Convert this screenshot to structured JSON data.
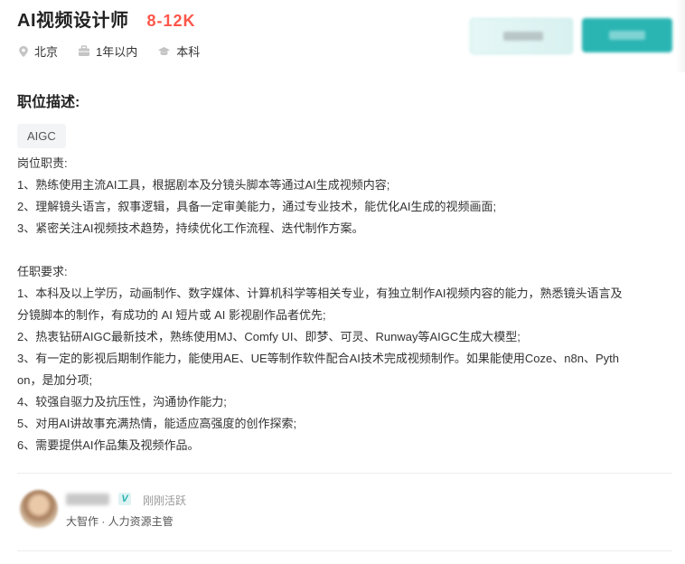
{
  "job": {
    "title": "AI视频设计师",
    "salary": "8-12K",
    "location": "北京",
    "experience": "1年以内",
    "education": "本科"
  },
  "icons": {
    "location": "location-pin-icon",
    "experience": "briefcase-icon",
    "education": "graduation-cap-icon"
  },
  "description": {
    "heading": "职位描述:",
    "tag": "AIGC",
    "lines": [
      "岗位职责:",
      "1、熟练使用主流AI工具，根据剧本及分镜头脚本等通过AI生成视频内容;",
      "2、理解镜头语言，叙事逻辑，具备一定审美能力，通过专业技术，能优化AI生成的视频画面;",
      "3、紧密关注AI视频技术趋势，持续优化工作流程、迭代制作方案。",
      "",
      "任职要求:",
      "1、本科及以上学历，动画制作、数字媒体、计算机科学等相关专业，有独立制作AI视频内容的能力，熟悉镜头语言及",
      "分镜脚本的制作，有成功的 AI 短片或 AI 影视剧作品者优先;",
      "2、热衷钻研AIGC最新技术，熟练使用MJ、Comfy UI、即梦、可灵、Runway等AIGC生成大模型;",
      "3、有一定的影视后期制作能力，能使用AE、UE等制作软件配合AI技术完成视频制作。如果能使用Coze、n8n、Pyth",
      "on，是加分项;",
      "4、较强自驱力及抗压性，沟通协作能力;",
      "5、对用AI讲故事充满热情，能适应高强度的创作探索;",
      "6、需要提供AI作品集及视频作品。"
    ]
  },
  "recruiter": {
    "verified_badge": "V",
    "status": "刚刚活跃",
    "company_title": "大智作 · 人力资源主管"
  },
  "colors": {
    "salary": "#fe574a",
    "accent": "#2ab5b3"
  }
}
